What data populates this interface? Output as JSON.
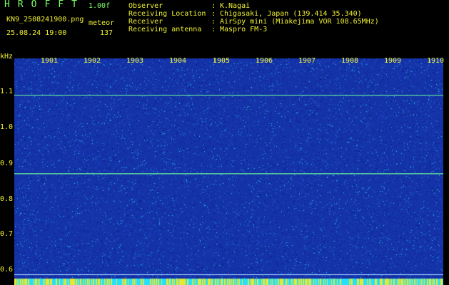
{
  "header": {
    "title": "HROFFT",
    "version": "1.00f",
    "filename": "KN9_2508241900.png",
    "meteor_label": "meteor",
    "datetime": "25.08.24 19:00",
    "meteor_count": "137"
  },
  "meta": {
    "labels": [
      "Observer",
      "Receiving Location",
      "Receiver",
      "Receiving antenna"
    ],
    "colon": ":",
    "values": [
      "K.Nagai",
      "Chigasaki, Japan (139.414 35.340)",
      "AirSpy mini (Miakejima VOR 108.65MHz)",
      "Maspro FM-3"
    ]
  },
  "spectrogram": {
    "y_unit": "kHz",
    "y_ticks": [
      "1.1",
      "1.0",
      "0.9",
      "0.8",
      "0.7",
      "0.6"
    ],
    "x_ticks": [
      "1901",
      "1902",
      "1903",
      "1904",
      "1905",
      "1906",
      "1907",
      "1908",
      "1909",
      "1910"
    ],
    "y_range_khz": [
      0.585,
      1.2
    ],
    "carrier_lines_khz": [
      1.1,
      0.887,
      0.613
    ],
    "colors": {
      "background": "#000000",
      "plot_base": "#1433a8",
      "noise_dark": "#0a1a80",
      "noise_mid": "#2a60e0",
      "noise_bright": "#22d0e8",
      "carrier": "#6cff9a",
      "axis_text": "#f0f034",
      "title_text": "#7dff66"
    }
  }
}
